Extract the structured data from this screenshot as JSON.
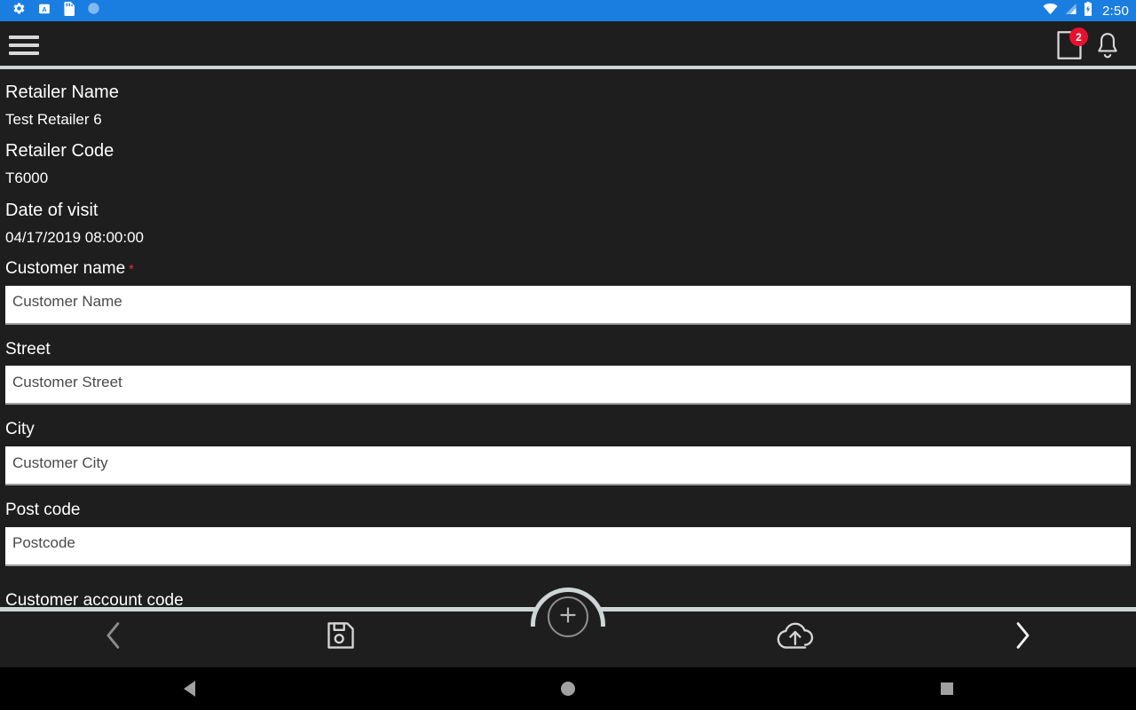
{
  "statusbar": {
    "icons": [
      "settings-gear-icon",
      "keyboard-input-icon",
      "sd-card-icon",
      "sync-circle-icon"
    ],
    "wifi_icon": "wifi-icon",
    "signal_icon": "cell-signal-icon",
    "battery_icon": "battery-charging-icon",
    "clock": "2:50"
  },
  "appbar": {
    "menu_icon": "hamburger-menu-icon",
    "notes_icon": "notes-document-icon",
    "notes_badge": "2",
    "bell_icon": "notification-bell-icon"
  },
  "form": {
    "fields": [
      {
        "label": "Retailer Name",
        "value": "Test Retailer 6",
        "type": "readonly"
      },
      {
        "label": "Retailer Code",
        "value": "T6000",
        "type": "readonly"
      },
      {
        "label": "Date of visit",
        "value": "04/17/2019 08:00:00",
        "type": "readonly"
      },
      {
        "label": "Customer name",
        "required": true,
        "placeholder": "Customer Name",
        "type": "text"
      },
      {
        "label": "Street",
        "required": false,
        "placeholder": "Customer Street",
        "type": "text"
      },
      {
        "label": "City",
        "required": false,
        "placeholder": "Customer City",
        "type": "text"
      },
      {
        "label": "Post code",
        "required": false,
        "placeholder": "Postcode",
        "type": "text"
      }
    ],
    "clipped_label": "Customer account code",
    "required_marker": "*"
  },
  "bottombar": {
    "prev_icon": "chevron-left-icon",
    "save_icon": "save-floppy-icon",
    "add_icon": "plus-circle-icon",
    "upload_icon": "cloud-upload-icon",
    "next_icon": "chevron-right-icon"
  },
  "navbar": {
    "back": "android-back-icon",
    "home": "android-home-icon",
    "recents": "android-recents-icon"
  },
  "colors": {
    "statusbar_blue": "#1a7ee0",
    "background_dark": "#1e1e1e",
    "divider_light": "#cdd5d6",
    "badge_red": "#e8112d",
    "required_red": "#e03030"
  }
}
